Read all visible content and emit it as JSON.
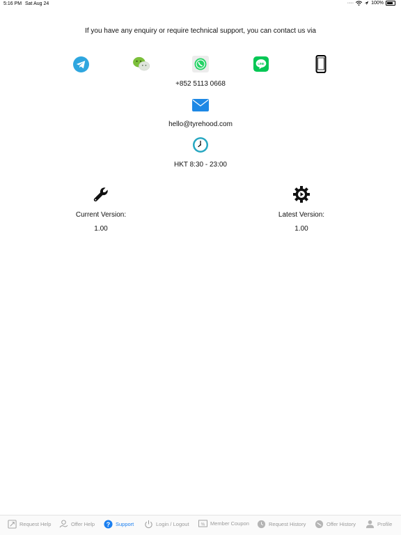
{
  "status": {
    "time": "5:16 PM",
    "date": "Sat Aug 24",
    "battery": "100%"
  },
  "intro_text": "If you have any enquiry or require technical support, you can contact us via",
  "contacts": {
    "icons": [
      "telegram-icon",
      "wechat-icon",
      "whatsapp-icon",
      "line-icon",
      "phone-icon"
    ],
    "phone": "+852 5113 0668",
    "email": "hello@tyrehood.com",
    "hours": "HKT 8:30 - 23:00"
  },
  "versions": {
    "current_label": "Current Version:",
    "current_value": "1.00",
    "latest_label": "Latest Version:",
    "latest_value": "1.00"
  },
  "tabs": [
    {
      "label": "Request Help",
      "icon": "request-help-icon",
      "active": false
    },
    {
      "label": "Offer Help",
      "icon": "offer-help-icon",
      "active": false
    },
    {
      "label": "Support",
      "icon": "question-icon",
      "active": true
    },
    {
      "label": "Login / Logout",
      "icon": "power-icon",
      "active": false
    },
    {
      "label": "Member Coupon",
      "icon": "coupon-icon",
      "active": false
    },
    {
      "label": "Request History",
      "icon": "request-history-icon",
      "active": false
    },
    {
      "label": "Offer History",
      "icon": "offer-history-icon",
      "active": false
    },
    {
      "label": "Profile",
      "icon": "profile-icon",
      "active": false
    }
  ],
  "colors": {
    "telegram": "#2ea6df",
    "wechat": "#7bbf3a",
    "whatsapp": "#25d366",
    "line": "#06c755",
    "mail": "#1e88e5",
    "clock": "#26a7c1",
    "tab_active": "#1b7ff0",
    "tab_inactive": "#9a9a9a"
  }
}
